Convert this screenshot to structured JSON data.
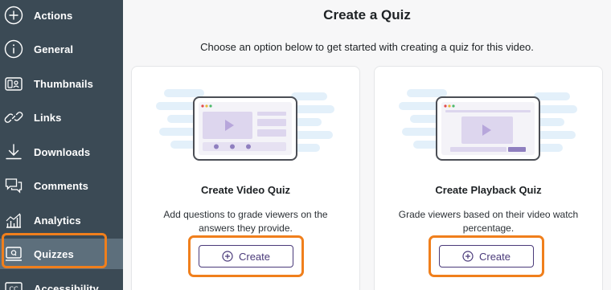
{
  "sidebar": {
    "items": [
      {
        "label": "Actions",
        "icon": "plus-circle-icon"
      },
      {
        "label": "General",
        "icon": "info-circle-icon"
      },
      {
        "label": "Thumbnails",
        "icon": "thumbnails-icon"
      },
      {
        "label": "Links",
        "icon": "link-icon"
      },
      {
        "label": "Downloads",
        "icon": "download-icon"
      },
      {
        "label": "Comments",
        "icon": "comments-icon"
      },
      {
        "label": "Analytics",
        "icon": "analytics-icon"
      },
      {
        "label": "Quizzes",
        "icon": "quiz-icon",
        "active": true
      },
      {
        "label": "Accessibility",
        "icon": "closed-captions-icon"
      }
    ],
    "highlight_color": "#f07f1c"
  },
  "main": {
    "title": "Create a Quiz",
    "subtitle": "Choose an option below to get started with creating a quiz for this video.",
    "cards": [
      {
        "title": "Create Video Quiz",
        "description": "Add questions to grade viewers on the answers they provide.",
        "button_label": "Create"
      },
      {
        "title": "Create Playback Quiz",
        "description": "Grade viewers based on their video watch percentage.",
        "button_label": "Create"
      }
    ]
  },
  "colors": {
    "sidebar_bg": "#3b4a55",
    "sidebar_active": "#5d6f7c",
    "accent_orange": "#f07f1c",
    "button_purple": "#4a3a7a",
    "illustration_purple": "#c9bde3",
    "illustration_blue": "#e6f2fb"
  }
}
